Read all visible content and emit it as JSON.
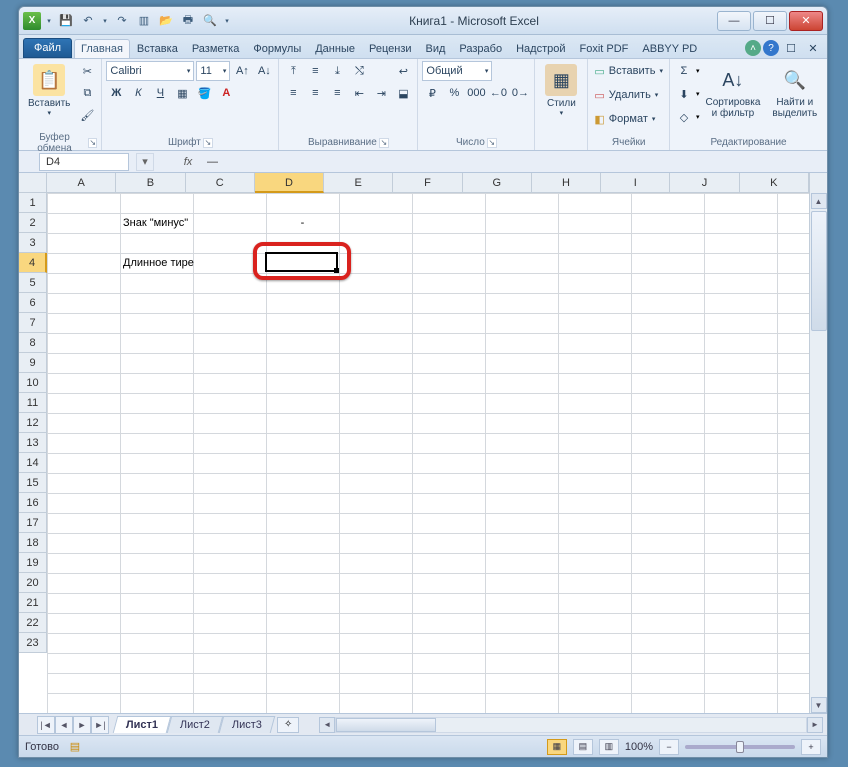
{
  "title": "Книга1  -  Microsoft Excel",
  "qat": {
    "save": "💾",
    "undo": "↶",
    "redo": "↷",
    "new": "▥",
    "open": "📂",
    "print": "🖶",
    "preview": "🔍"
  },
  "tabs": {
    "file": "Файл",
    "items": [
      "Главная",
      "Вставка",
      "Разметка",
      "Формулы",
      "Данные",
      "Рецензи",
      "Вид",
      "Разрабо",
      "Надстрой",
      "Foxit PDF",
      "ABBYY PD"
    ],
    "active": 0
  },
  "ribbon": {
    "clipboard": {
      "paste": "Вставить",
      "label": "Буфер обмена"
    },
    "font": {
      "name": "Calibri",
      "size": "11",
      "bold": "Ж",
      "italic": "К",
      "underline": "Ч",
      "label": "Шрифт"
    },
    "align": {
      "label": "Выравнивание"
    },
    "number": {
      "format": "Общий",
      "label": "Число"
    },
    "styles": {
      "btn": "Стили"
    },
    "cells": {
      "insert": "Вставить",
      "delete": "Удалить",
      "format": "Формат",
      "label": "Ячейки"
    },
    "editing": {
      "sort": "Сортировка и фильтр",
      "find": "Найти и выделить",
      "label": "Редактирование"
    }
  },
  "namebox": "D4",
  "fx": "fx",
  "formula": "—",
  "columns": [
    "A",
    "B",
    "C",
    "D",
    "E",
    "F",
    "G",
    "H",
    "I",
    "J",
    "K"
  ],
  "rows": [
    "1",
    "2",
    "3",
    "4",
    "5",
    "6",
    "7",
    "8",
    "9",
    "10",
    "11",
    "12",
    "13",
    "14",
    "15",
    "16",
    "17",
    "18",
    "19",
    "20",
    "21",
    "22",
    "23"
  ],
  "selected": {
    "col": 3,
    "row": 3
  },
  "cellsdata": {
    "b2": "Знак \"минус\"",
    "d2": "-",
    "b4": "Длинное тире",
    "d4": "—"
  },
  "sheets": {
    "items": [
      "Лист1",
      "Лист2",
      "Лист3"
    ],
    "active": 0
  },
  "status": {
    "ready": "Готово",
    "zoom": "100%"
  },
  "glyph": {
    "dd": "▾",
    "min": "—",
    "max": "☐",
    "close": "✕",
    "help": "?",
    "up": "▲",
    "down": "▼",
    "left": "◄",
    "right": "►",
    "first": "|◄",
    "last": "►|",
    "plus": "+",
    "minus": "−",
    "sum": "Σ",
    "fill": "⬇",
    "clear": "◇",
    "find": "🔍",
    "sort": "A↓",
    "cut": "✂",
    "copy": "⧉",
    "brush": "🖌",
    "styles": "▦",
    "wrap": "↩",
    "merge": "⬓",
    "border": "▦",
    "fillc": "🪣",
    "fontc": "A",
    "pct": "%",
    "comma": "000",
    "inc": "←0",
    "dec": "0→",
    "cur": "₽",
    "macro": "▤"
  }
}
